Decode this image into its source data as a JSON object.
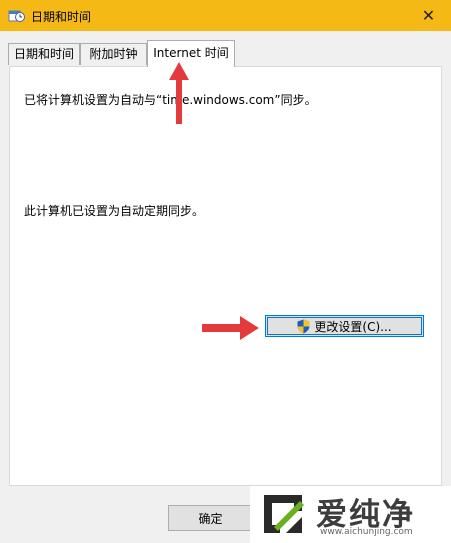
{
  "window": {
    "title": "日期和时间",
    "close_glyph": "✕"
  },
  "tabs": [
    {
      "label": "日期和时间"
    },
    {
      "label": "附加时钟"
    },
    {
      "label": "Internet 时间"
    }
  ],
  "panel": {
    "sync_status": "已将计算机设置为自动与“time.windows.com”同步。",
    "schedule_status": "此计算机已设置为自动定期同步。",
    "change_settings_label": "更改设置(C)..."
  },
  "footer": {
    "ok_label": "确定"
  },
  "watermark": {
    "brand_text": "爱纯净",
    "url": "www.aichunjing.com"
  },
  "colors": {
    "titlebar": "#f5b915",
    "annotation_arrow": "#e33b3b",
    "focus_border": "#0078d7"
  },
  "icons": {
    "app": "clock-calendar-icon",
    "change": "uac-shield-icon"
  }
}
